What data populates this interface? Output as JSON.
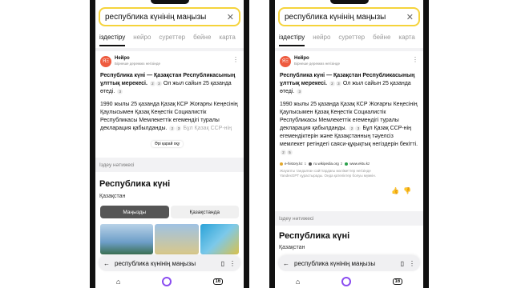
{
  "search": {
    "query": "республика күнінің маңызы"
  },
  "tabs": [
    "іздестіру",
    "нейро",
    "суреттер",
    "бейне",
    "карта"
  ],
  "neuro": {
    "name": "Нейро",
    "subtitle": "Бірнеше дереккөз негізінде",
    "title_bold": "Республика күні — Қазақстан Республикасының ұлттық мерекесі.",
    "title_rest": "Ол жыл сайын 25 қазанда өтеді.",
    "badges": [
      "2",
      "3"
    ],
    "badge2": "3",
    "para1": "1990 жылы 25 қазанда Қазақ КСР Жоғарғы Кеңесінің Қаулысымен Қазақ Кеңестік Социалистік Республикасы Мемлекеттік егемендігі туралы декларация қабылданды.",
    "badges_p1": [
      "2",
      "3"
    ],
    "para1_tail": "Бұл Қазақ ССР-нің",
    "para1_full_tail": "Бұл Қазақ ССР-нің егемендіктерін және Қазақстанның тәуелсіз мемлекет ретіндегі саяси-құқықтық негіздерін бекітті.",
    "badges_p2": [
      "2",
      "5"
    ],
    "read_more": "Әрі қарай оқу",
    "sources": [
      {
        "label": "e-history.kz",
        "count": "1",
        "color": "#e2a72b"
      },
      {
        "label": "ru.wikipedia.org",
        "count": "2",
        "color": "#555555"
      },
      {
        "label": "www.ektu.kz",
        "count": "",
        "color": "#2aa04b"
      }
    ],
    "disclaimer": "Жауапты тандалған сайттардағы мәліметтер негізінде YandexGPT құрастырады. Онда қателіктер болуы мүмкін."
  },
  "results": {
    "header": "Іздеу нәтижесі",
    "title": "Республика күні",
    "subtitle": "Қазақстан",
    "segments": [
      "Маңызды",
      "Қазақстанда"
    ]
  },
  "bottom_bar": {
    "url": "республика күнінің маңызы"
  },
  "nav": {
    "tabs_count": "16"
  }
}
